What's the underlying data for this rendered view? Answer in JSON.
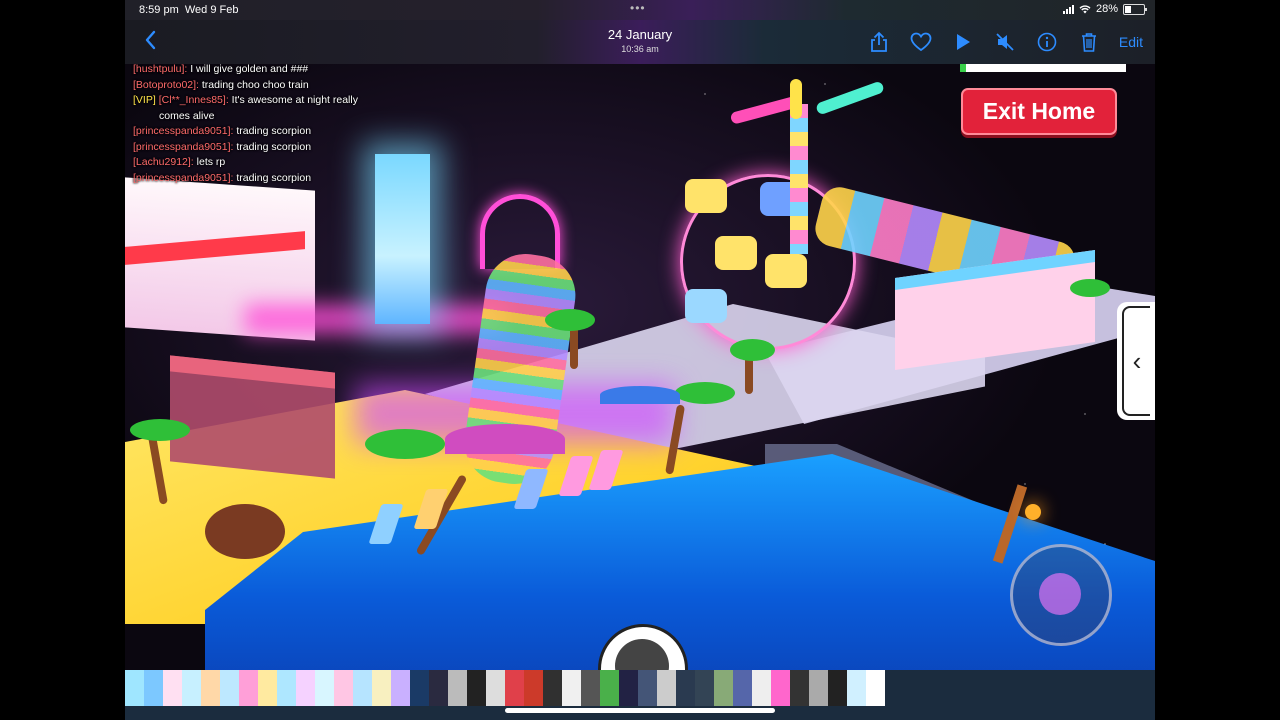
{
  "status_bar": {
    "time": "8:59 pm",
    "date": "Wed 9 Feb",
    "dots": "•••",
    "battery": "28%"
  },
  "photo_nav": {
    "back_icon": "chevron-left-icon",
    "title": "24 January",
    "subtitle": "10:36 am",
    "actions": [
      "share-icon",
      "heart-icon",
      "play-icon",
      "mute-icon",
      "info-icon",
      "trash-icon"
    ],
    "edit_label": "Edit",
    "accent_color": "#2d8cff"
  },
  "game": {
    "chat": [
      {
        "name": "[hushtpulu]:",
        "message": "I will give golden and ###",
        "vip": ""
      },
      {
        "name": "[Botoproto02]:",
        "message": "trading choo choo train",
        "vip": ""
      },
      {
        "name": "[Cl**_Innes85]:",
        "message": "It's awesome at night really",
        "vip": "[VIP]"
      },
      {
        "name": "",
        "message": "comes alive",
        "vip": ""
      },
      {
        "name": "[princesspanda9051]:",
        "message": "trading scorpion",
        "vip": ""
      },
      {
        "name": "[princesspanda9051]:",
        "message": "trading scorpion",
        "vip": ""
      },
      {
        "name": "[Lachu2912]:",
        "message": "lets rp",
        "vip": ""
      },
      {
        "name": "[princesspanda9051]:",
        "message": "trading scorpion",
        "vip": ""
      }
    ],
    "exit_button_label": "Exit Home",
    "exit_button_color": "#e2223a",
    "side_tab_icon": "chevron-left-icon",
    "joystick_icon": "joystick-icon",
    "avatar_button_icon": "avatar-icon"
  },
  "thumbnail_strip": {
    "colors": [
      "#9fe6ff",
      "#7cc8ff",
      "#ffe0f2",
      "#c7f0ff",
      "#ffd8a8",
      "#bde8ff",
      "#ff9fd8",
      "#ffeaa0",
      "#aee7ff",
      "#f5d2ff",
      "#d8f6ff",
      "#ffc6e4",
      "#b6e4ff",
      "#f8f0c0",
      "#c9b0ff",
      "#1a3a66",
      "#2a2a40",
      "#bbbbbb",
      "#222222",
      "#dddddd",
      "#e0404a",
      "#cc3a2a",
      "#303030",
      "#f0f0f0",
      "#555555",
      "#4ab04a",
      "#222244",
      "#445577",
      "#cccccc",
      "#2a3a50",
      "#334455",
      "#88aa77",
      "#5566aa",
      "#eeeeee",
      "#ff66cc",
      "#333333",
      "#aaaaaa",
      "#222222",
      "#d0f0ff",
      "#ffffff"
    ]
  }
}
